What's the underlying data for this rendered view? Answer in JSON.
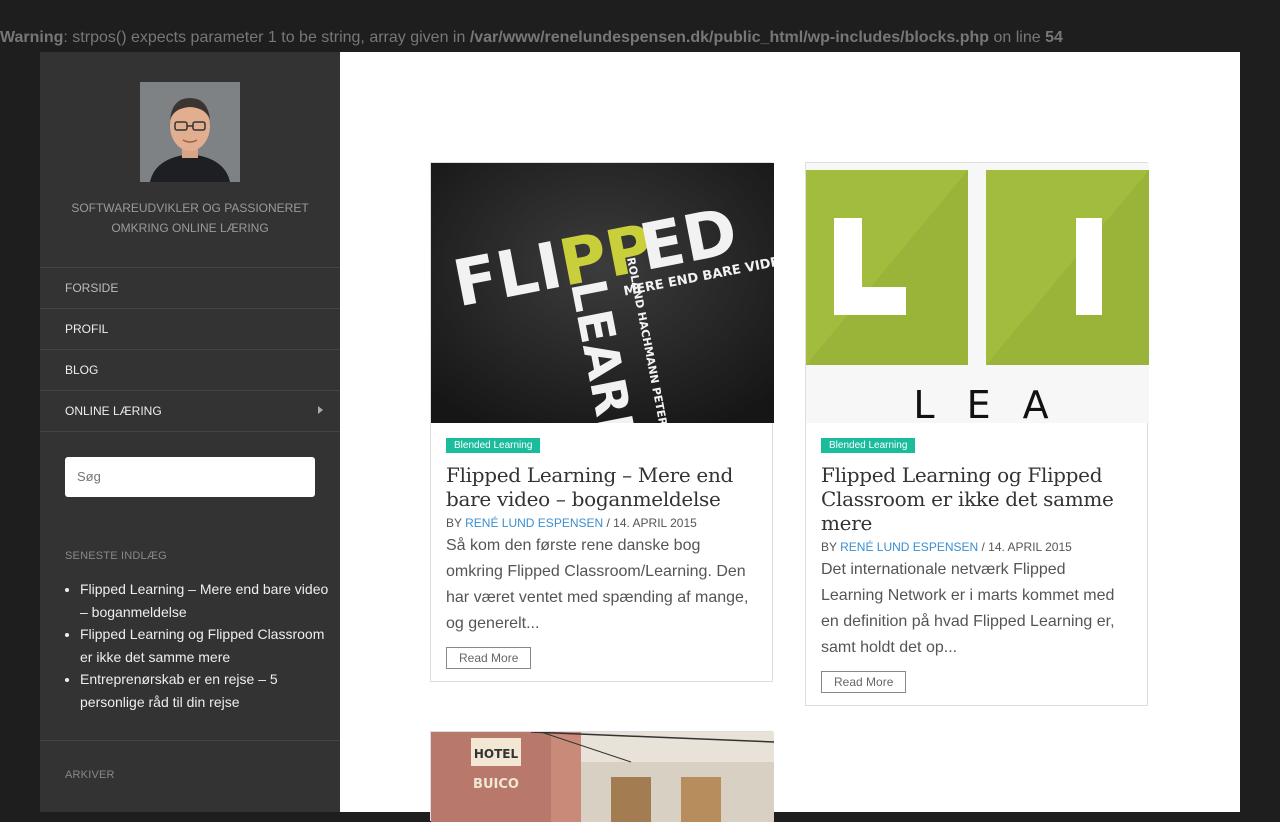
{
  "warning": {
    "label": "Warning",
    "message": ": strpos() expects parameter 1 to be string, array given in ",
    "path": "/var/www/renelundespensen.dk/public_html/wp-includes/blocks.php",
    "on_line": " on line ",
    "line": "54"
  },
  "sidebar": {
    "tagline": "Softwareudvikler og passioneret omkring online læring",
    "menu": [
      {
        "label": "Forside"
      },
      {
        "label": "Profil"
      },
      {
        "label": "Blog"
      },
      {
        "label": "Online læring",
        "has_children": true
      }
    ],
    "search_placeholder": "Søg",
    "recent_title": "Seneste indlæg",
    "recent": [
      "Flipped Learning – Mere end bare video – boganmeldelse",
      "Flipped Learning og Flipped Classroom er ikke det samme mere",
      "Entreprenørskab er en rejse – 5 personlige råd til din rejse"
    ],
    "archive_title": "Arkiver"
  },
  "posts": [
    {
      "category": "Blended Learning",
      "title": "Flipped Learning – Mere end bare video – boganmeldelse",
      "by": "BY ",
      "author": "René Lund Espensen",
      "date": " / 14. APRIL 2015",
      "excerpt": "Så kom den første rene danske bog omkring Flipped Classroom/Learning. Den har været ventet med spænding af mange, og generelt...",
      "read_more": "Read More",
      "cover": {
        "word1": "FLI",
        "word2": "PP",
        "word3": "ED",
        "sub": "MERE END BARE VIDEO",
        "vertical": "LEARNIN",
        "authors": "ROLAND HACHMANN   PETER HO"
      }
    },
    {
      "category": "Blended Learning",
      "title": "Flipped Learning og Flipped Classroom er ikke det samme mere",
      "by": "BY ",
      "author": "René Lund Espensen",
      "date": " / 14. APRIL 2015",
      "excerpt": "Det internationale netværk Flipped Learning Network er i marts kommet med en definition på hvad Flipped Learning er, samt holdt det op...",
      "read_more": "Read More",
      "cover": {
        "letter1": "L",
        "letter2": "I",
        "bottom": "L  E  A"
      }
    },
    {
      "cover": {
        "sign1": "HOTEL",
        "sign2": "BUICO"
      }
    }
  ]
}
